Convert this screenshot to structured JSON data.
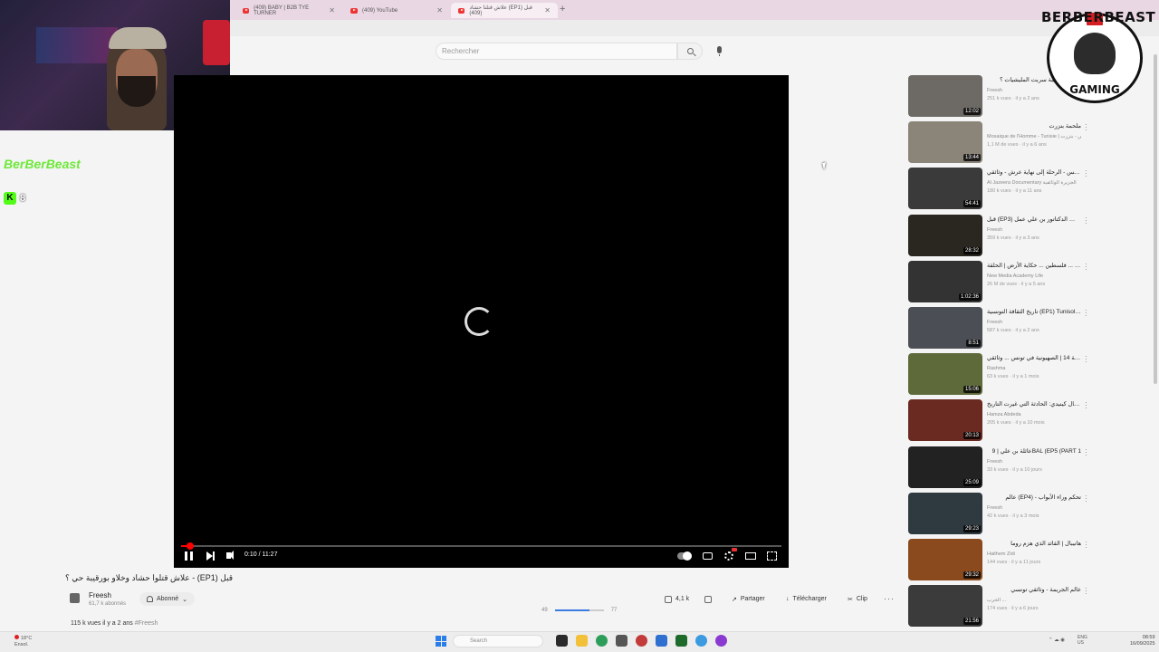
{
  "browser": {
    "tabs": [
      {
        "title": "(409) BABY | B2B TYE TURNER",
        "active": false
      },
      {
        "title": "(409) YouTube",
        "active": false
      },
      {
        "title": "علاش قتلنا حشاد (EP1) قبل (409)",
        "active": true
      }
    ],
    "new_tab": "+"
  },
  "search": {
    "placeholder": "Rechercher"
  },
  "overlay": {
    "kick_name": "BerBerBeast",
    "kick_logo": "K",
    "kick_count": "8",
    "logo_top": "BERBERBEAST",
    "logo_bottom": "GAMING"
  },
  "player": {
    "time": "0:10 / 11:27",
    "progress": 0.015
  },
  "video": {
    "title": "علاش قتلوا حشاد وخلاو بورقيبة حي ؟ - (EP1) قبل",
    "channel": "Freesh",
    "subscribers": "61,7 k abonnés",
    "subscribe_label": "Abonné",
    "views": "115 k vues",
    "age": "il y a 2 ans",
    "hashtag": "#Freesh"
  },
  "actions": {
    "likes": "4,1 k",
    "share": "Partager",
    "download": "Télécharger",
    "clip": "Clip",
    "more": "···"
  },
  "volume": {
    "left": "49",
    "right": "77",
    "level": 0.7
  },
  "related": [
    {
      "title": "علاش بورقيبة سربت المليشيات ؟",
      "channel": "Freesh",
      "meta": "251 k vues · il y a 2 ans",
      "duration": "12:02",
      "color": "#6d6a66"
    },
    {
      "title": "ملحمة بنزرت",
      "channel": "Mosaique de l'Homme - Tunisie | تونس - بنزرت",
      "meta": "1,1 M de vues · il y a 6 ans",
      "duration": "13:44",
      "color": "#8b8478"
    },
    {
      "title": "محمد الخامس - الرحلة إلى نهاية عرش - وثائقي",
      "channel": "Al Jazeera Documentary الجزيرة الوثائقية",
      "meta": "180 k vues · il y a 11 ans",
      "duration": "54:41",
      "color": "#3a3a3a"
    },
    {
      "title": "قبل (EP3) كيفاش الدكتاتور بن علي عمل...",
      "channel": "Freesh",
      "meta": "359 k vues · il y a 3 ans",
      "duration": "28:32",
      "color": "#2a2620"
    },
    {
      "title": "فلسطين ... حكاية الأرض | الحلقة ... Palestine ... a Tale of Land",
      "channel": "New Media Academy Life",
      "meta": "26 M de vues · il y a 5 ans",
      "duration": "1:02:36",
      "color": "#333333"
    },
    {
      "title": "تاريخ الثقافة التونسية (EP1) Tunisologie",
      "channel": "Freesh",
      "meta": "587 k vues · il y a 2 ans",
      "duration": "8:51",
      "color": "#4b4f55"
    },
    {
      "title": "الجولة 14 | الصهيونية في تونس ... وثائقي",
      "channel": "Rashma",
      "meta": "63 k vues · il y a 1 mois",
      "duration": "15:06",
      "color": "#5e6a3a"
    },
    {
      "title": "اغتيال كينيدي: الحادثة التي غيرت التاريخ",
      "channel": "Hamza Abdeda",
      "meta": "205 k vues · il y a 10 mois",
      "duration": "20:13",
      "color": "#6a2a22"
    },
    {
      "title": "عائلة بن علي | 9BAL (EP5 (PART 1",
      "channel": "Freesh",
      "meta": "33 k vues · il y a 10 jours",
      "duration": "25:09",
      "color": "#222222"
    },
    {
      "title": "عالم (EP4) - تحكم وراء الأبواب",
      "channel": "Freesh",
      "meta": "42 k vues · il y a 3 mois",
      "duration": "29:23",
      "color": "#2e3a40"
    },
    {
      "title": "هانيبال | القائد الذي هزم روما",
      "channel": "Haithem Zidi",
      "meta": "144 vues · il y a 11 jours",
      "duration": "29:32",
      "color": "#8a4a1e"
    },
    {
      "title": "عالم الجريمة - وثائقي تونسي",
      "channel": "الحرب ...",
      "meta": "174 vues · il y a 6 jours",
      "duration": "21:56",
      "color": "#3b3b3b"
    }
  ],
  "taskbar": {
    "temp": "18°C",
    "weather": "Ensol.",
    "search": "Search",
    "lang1": "ENG",
    "lang2": "US",
    "time": "08:59",
    "date": "16/09/2025",
    "win_blue": "#2b7de9"
  }
}
